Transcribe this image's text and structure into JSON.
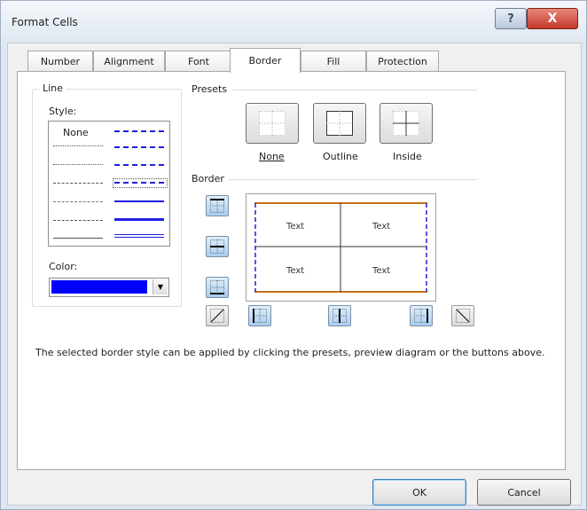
{
  "window": {
    "title": "Format Cells",
    "help_glyph": "?",
    "close_glyph": "X"
  },
  "tabs": [
    {
      "label": "Number",
      "active": false
    },
    {
      "label": "Alignment",
      "active": false
    },
    {
      "label": "Font",
      "active": false
    },
    {
      "label": "Border",
      "active": true
    },
    {
      "label": "Fill",
      "active": false
    },
    {
      "label": "Protection",
      "active": false
    }
  ],
  "line": {
    "group_label": "Line",
    "style_label": "Style:",
    "none_label": "None",
    "color_label": "Color:",
    "selected_color": "#0000ff"
  },
  "presets": {
    "group_label": "Presets",
    "none_label": "None",
    "outline_label": "Outline",
    "inside_label": "Inside"
  },
  "border": {
    "group_label": "Border",
    "preview_text": [
      "Text",
      "Text",
      "Text",
      "Text"
    ],
    "top_color": "#c76f18",
    "side_color": "#1f1fe0"
  },
  "description": "The selected border style can be applied by clicking the presets, preview diagram or the buttons above.",
  "buttons": {
    "ok": "OK",
    "cancel": "Cancel"
  }
}
